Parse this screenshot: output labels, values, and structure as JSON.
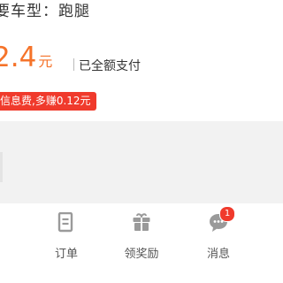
{
  "order": {
    "car_type_text": "要车型：跑腿",
    "amount_value": "2.4",
    "amount_unit": "元",
    "payment_status": "已全额支付",
    "info_fee_tag": "信息费,多赚0.12元"
  },
  "tabbar": {
    "home": {
      "label": ""
    },
    "orders": {
      "label": "订单",
      "icon": "list-icon"
    },
    "rewards": {
      "label": "领奖励",
      "icon": "gift-icon"
    },
    "messages": {
      "label": "消息",
      "icon": "chat-icon",
      "badge": "1"
    }
  },
  "colors": {
    "accent": "#f5732a",
    "badge": "#f03a2c",
    "tag_bg": "#f03a2c",
    "background_gap": "#f2f2f2"
  }
}
